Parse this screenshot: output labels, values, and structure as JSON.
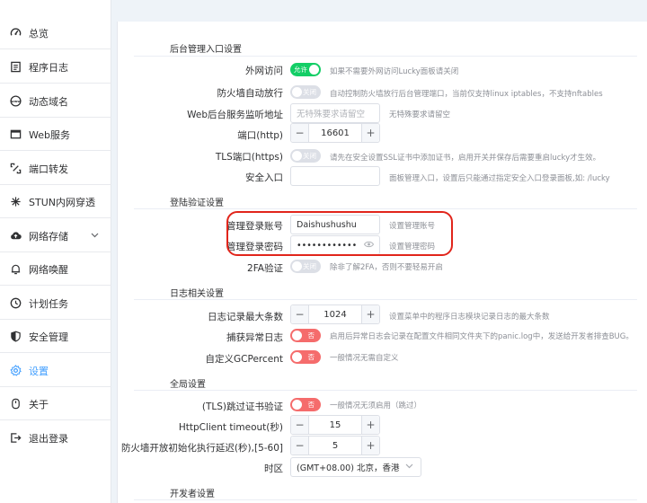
{
  "sidebar": {
    "items": [
      {
        "label": "总览",
        "icon": "dashboard-icon"
      },
      {
        "label": "程序日志",
        "icon": "log-icon"
      },
      {
        "label": "动态域名",
        "icon": "www-icon"
      },
      {
        "label": "Web服务",
        "icon": "web-icon"
      },
      {
        "label": "端口转发",
        "icon": "port-forward-icon"
      },
      {
        "label": "STUN内网穿透",
        "icon": "stun-icon"
      },
      {
        "label": "网络存储",
        "icon": "cloud-icon"
      },
      {
        "label": "网络唤醒",
        "icon": "bell-icon"
      },
      {
        "label": "计划任务",
        "icon": "clock-icon"
      },
      {
        "label": "安全管理",
        "icon": "shield-icon"
      },
      {
        "label": "设置",
        "icon": "gear-icon"
      },
      {
        "label": "关于",
        "icon": "info-icon"
      },
      {
        "label": "退出登录",
        "icon": "logout-icon"
      }
    ],
    "active_index": 10
  },
  "sections": {
    "admin_entry": "后台管理入口设置",
    "login_auth": "登陆验证设置",
    "log": "日志相关设置",
    "global": "全局设置",
    "developer": "开发者设置"
  },
  "admin_entry": {
    "external_access": {
      "label": "外网访问",
      "switch_text": "允许",
      "hint": "如果不需要外网访问Lucky面板请关闭"
    },
    "firewall_auto": {
      "label": "防火墙自动放行",
      "switch_text": "关闭",
      "hint": "自动控制防火墙放行后台管理端口，当前仅支持linux iptables，不支持nftables"
    },
    "listen_addr": {
      "label": "Web后台服务监听地址",
      "placeholder": "无特殊要求请留空",
      "hint": "无特殊要求请留空"
    },
    "port": {
      "label": "端口(http)",
      "value": "16601"
    },
    "tls_port": {
      "label": "TLS端口(https)",
      "switch_text": "关闭",
      "hint": "请先在安全设置SSL证书中添加证书，启用开关并保存后需要重启lucky才生效。"
    },
    "safe_entry": {
      "label": "安全入口",
      "value": "",
      "hint": "面板管理入口，设置后只能通过指定安全入口登录面板,如: /lucky"
    }
  },
  "login_auth": {
    "account": {
      "label": "管理登录账号",
      "value": "Daishushushu",
      "hint": "设置管理账号"
    },
    "password": {
      "label": "管理登录密码",
      "value": "••••••••••••",
      "hint": "设置管理密码"
    },
    "twofa": {
      "label": "2FA验证",
      "switch_text": "关闭",
      "hint": "除非了解2FA，否则不要轻易开启"
    }
  },
  "log": {
    "max_entries": {
      "label": "日志记录最大条数",
      "value": "1024",
      "hint": "设置菜单中的程序日志模块记录日志的最大条数"
    },
    "capture_exception": {
      "label": "捕获异常日志",
      "switch_text": "否",
      "hint": "启用后异常日志会记录在配置文件相同文件夹下的panic.log中，发送给开发者排查BUG。"
    },
    "gc_percent": {
      "label": "自定义GCPercent",
      "switch_text": "否",
      "hint": "一般情况无需自定义"
    }
  },
  "global": {
    "tls_skip_verify": {
      "label": "(TLS)跳过证书验证",
      "switch_text": "否",
      "hint": "一般情况无须启用（跳过）"
    },
    "http_timeout": {
      "label": "HttpClient timeout(秒)",
      "value": "15"
    },
    "firewall_delay": {
      "label": "防火墙开放初始化执行延迟(秒),[5-60]",
      "value": "5"
    },
    "timezone": {
      "label": "时区",
      "value": "(GMT+08.00) 北京，香港"
    }
  },
  "colors": {
    "accent": "#409eff",
    "switch_green": "#13ce66",
    "switch_red": "#f56c6c",
    "highlight_red": "#e1251b"
  }
}
